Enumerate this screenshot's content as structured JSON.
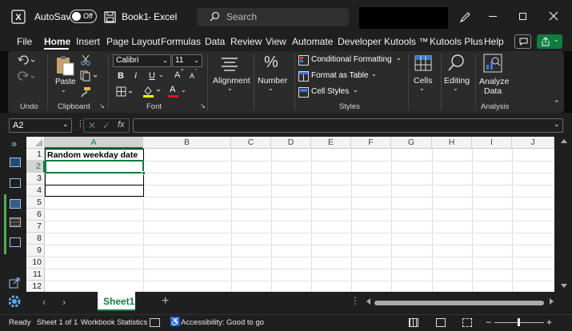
{
  "titlebar": {
    "autosave_label": "AutoSave",
    "autosave_state": "Off",
    "workbook_name": "Book1",
    "separator": "-",
    "app_name": "Excel",
    "search_placeholder": "Search"
  },
  "menu": {
    "items": [
      "File",
      "Home",
      "Insert",
      "Page Layout",
      "Formulas",
      "Data",
      "Review",
      "View",
      "Automate",
      "Developer",
      "Kutools ™",
      "Kutools Plus",
      "Help"
    ],
    "active": "Home"
  },
  "ribbon": {
    "undo_group": "Undo",
    "clipboard_group": "Clipboard",
    "paste_label": "Paste",
    "font_group": "Font",
    "font_name": "Calibri",
    "font_size": "11",
    "bold": "B",
    "italic": "I",
    "underline": "U",
    "grow_font": "A",
    "shrink_font": "A",
    "font_color_letter": "A",
    "alignment_label": "Alignment",
    "number_label": "Number",
    "number_icon": "%",
    "conditional_formatting": "Conditional Formatting",
    "format_as_table": "Format as Table",
    "cell_styles": "Cell Styles",
    "styles_group": "Styles",
    "cells_label": "Cells",
    "editing_label": "Editing",
    "analyze_label_1": "Analyze",
    "analyze_label_2": "Data",
    "analysis_group": "Analysis"
  },
  "formula_bar": {
    "name_box": "A2",
    "fx": "fx",
    "formula": ""
  },
  "grid": {
    "columns": [
      "A",
      "B",
      "C",
      "D",
      "E",
      "F",
      "G",
      "H",
      "I",
      "J"
    ],
    "rows": [
      "1",
      "2",
      "3",
      "4",
      "5",
      "6",
      "7",
      "8",
      "9",
      "10",
      "11",
      "12"
    ],
    "cell_a1": "Random weekday date"
  },
  "sheets": {
    "active": "Sheet1",
    "add": "+"
  },
  "status": {
    "ready": "Ready",
    "sheet_pos": "Sheet 1 of 1",
    "workbook_stats": "Workbook Statistics",
    "accessibility": "Accessibility: Good to go",
    "zoom_minus": "−",
    "zoom_plus": "+"
  },
  "colors": {
    "accent_green": "#107c41",
    "title_bg": "#1f1f1f",
    "ribbon_bg": "#2b2b2b",
    "highlight_yellow": "#ffff00",
    "font_red": "#e81123"
  }
}
